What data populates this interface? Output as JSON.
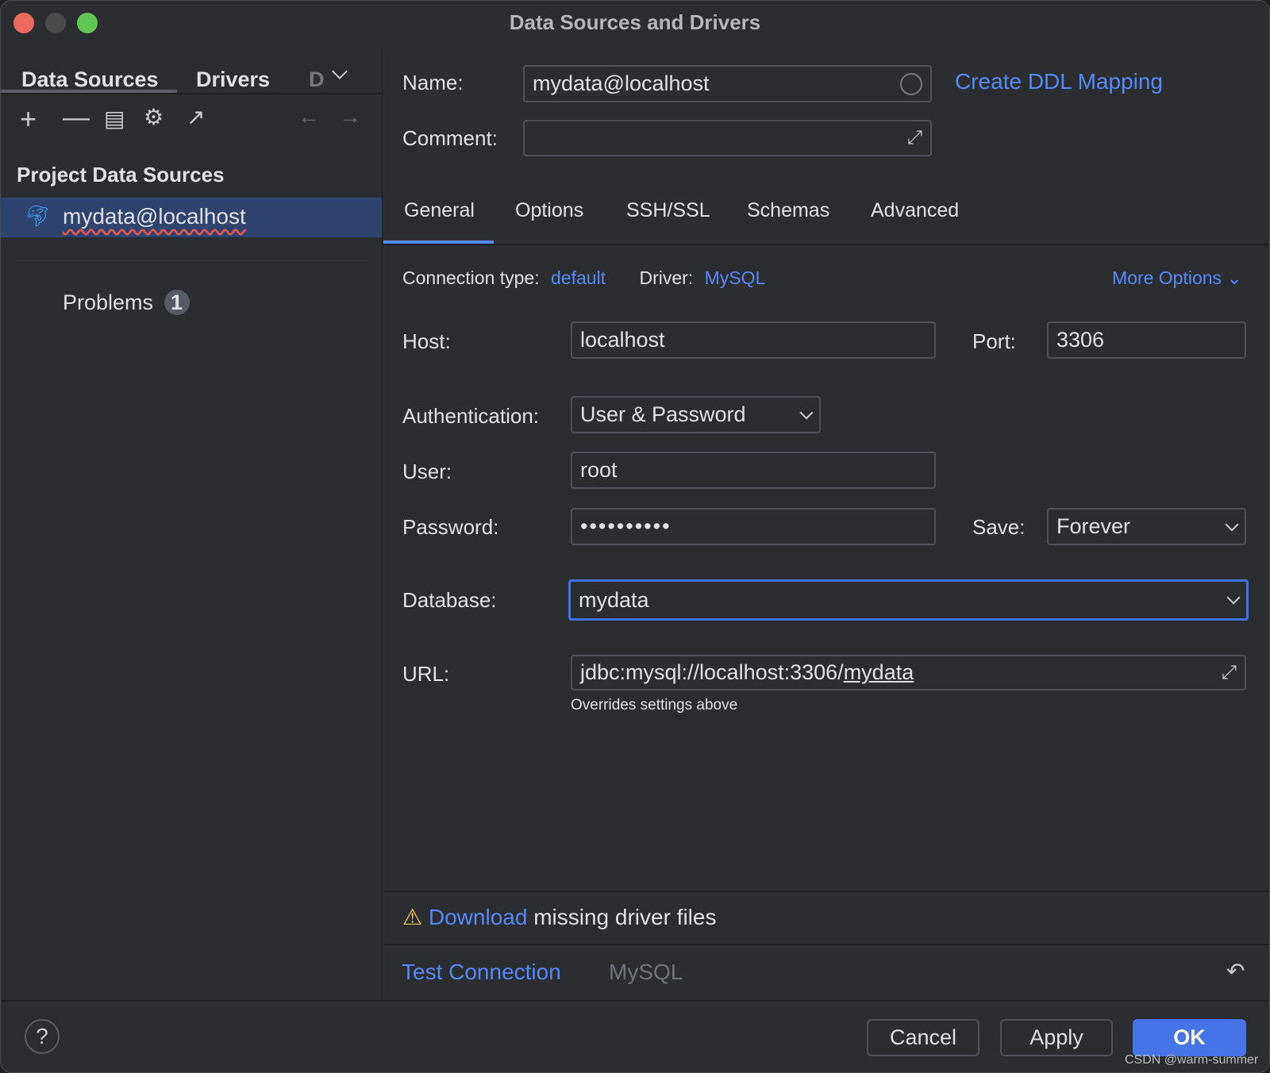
{
  "window": {
    "title": "Data Sources and Drivers"
  },
  "sidebar": {
    "tabs": [
      {
        "label": "Data Sources",
        "active": true
      },
      {
        "label": "Drivers"
      },
      {
        "label": "D"
      }
    ],
    "toolbar_icons": [
      "add-icon",
      "remove-icon",
      "duplicate-icon",
      "settings-icon",
      "open-external-icon",
      "back-arrow-icon",
      "forward-arrow-icon"
    ],
    "section_title": "Project Data Sources",
    "items": [
      {
        "label": "mydata@localhost",
        "icon": "mysql-dolphin-icon",
        "selected": true
      }
    ],
    "problems": {
      "label": "Problems",
      "count": "1"
    }
  },
  "form": {
    "name_label": "Name:",
    "name_value": "mydata@localhost",
    "create_ddl": "Create DDL Mapping",
    "comment_label": "Comment:",
    "comment_value": "",
    "tabs": [
      "General",
      "Options",
      "SSH/SSL",
      "Schemas",
      "Advanced"
    ],
    "active_tab": "General",
    "connection_type_label": "Connection type:",
    "connection_type": "default",
    "driver_label": "Driver:",
    "driver": "MySQL",
    "more_options": "More Options",
    "host_label": "Host:",
    "host": "localhost",
    "port_label": "Port:",
    "port": "3306",
    "auth_label": "Authentication:",
    "auth": "User & Password",
    "user_label": "User:",
    "user": "root",
    "password_label": "Password:",
    "password": "••••••••••",
    "save_label": "Save:",
    "save": "Forever",
    "database_label": "Database:",
    "database": "mydata",
    "url_label": "URL:",
    "url_prefix": "jdbc:mysql://localhost:3306/",
    "url_db": "mydata",
    "url_hint": "Overrides settings above"
  },
  "warning": {
    "link": "Download",
    "text": " missing driver files"
  },
  "footer": {
    "test_connection": "Test Connection",
    "driver_name": "MySQL",
    "cancel": "Cancel",
    "apply": "Apply",
    "ok": "OK",
    "help": "?"
  },
  "colors": {
    "accent": "#548af7",
    "ok_button": "#4574e6",
    "selection": "#2e436e",
    "warning": "#f2c55c"
  },
  "watermark": "CSDN @warm-summer"
}
